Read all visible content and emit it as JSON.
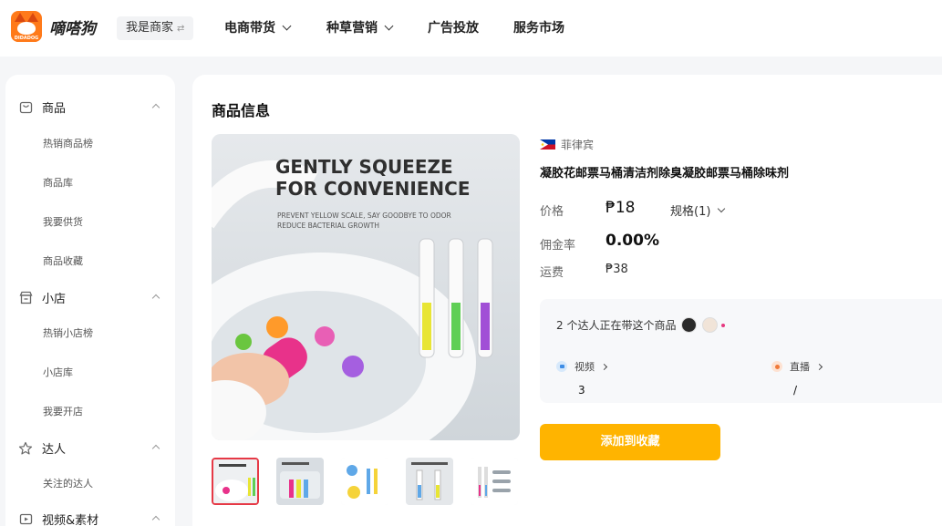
{
  "header": {
    "brand_name": "嘀嗒狗",
    "brand_tag": "DIDADOG",
    "merchant_switch": "我是商家",
    "nav": [
      {
        "label": "电商带货",
        "has_dropdown": true
      },
      {
        "label": "种草营销",
        "has_dropdown": true
      },
      {
        "label": "广告投放",
        "has_dropdown": false
      },
      {
        "label": "服务市场",
        "has_dropdown": false
      }
    ]
  },
  "sidebar": {
    "sections": [
      {
        "title": "商品",
        "icon": "bag-icon",
        "items": [
          "热销商品榜",
          "商品库",
          "我要供货",
          "商品收藏"
        ]
      },
      {
        "title": "小店",
        "icon": "store-icon",
        "items": [
          "热销小店榜",
          "小店库",
          "我要开店"
        ]
      },
      {
        "title": "达人",
        "icon": "star-icon",
        "items": [
          "关注的达人"
        ]
      },
      {
        "title": "视频&素材",
        "icon": "video-icon",
        "items": []
      }
    ]
  },
  "main": {
    "title": "商品信息",
    "hero_image": {
      "headline_line1": "GENTLY SQUEEZE",
      "headline_line2": "FOR CONVENIENCE",
      "sub_line1": "PREVENT YELLOW SCALE, SAY GOODBYE TO ODOR",
      "sub_line2": "REDUCE BACTERIAL GROWTH"
    },
    "thumbnails": [
      {
        "name": "thumb-1",
        "active": true
      },
      {
        "name": "thumb-2",
        "active": false
      },
      {
        "name": "thumb-3",
        "active": false
      },
      {
        "name": "thumb-4",
        "active": false
      },
      {
        "name": "thumb-5",
        "active": false
      }
    ],
    "product": {
      "country": "菲律宾",
      "title": "凝胶花邮票马桶清洁剂除臭凝胶邮票马桶除味剂",
      "price_label": "价格",
      "price": "₱18",
      "spec": "规格(1)",
      "commission_label": "佣金率",
      "commission": "0.00%",
      "shipping_label": "运费",
      "shipping": "₱38"
    },
    "promoters": {
      "headline": "2 个达人正在带这个商品",
      "video_label": "视频",
      "video_count": "3",
      "live_label": "直播",
      "live_count": "/"
    },
    "add_button": "添加到收藏"
  },
  "colors": {
    "accent": "#ffb400",
    "active_thumb_border": "#e63946",
    "brand_orange": "#ff7a1a"
  }
}
